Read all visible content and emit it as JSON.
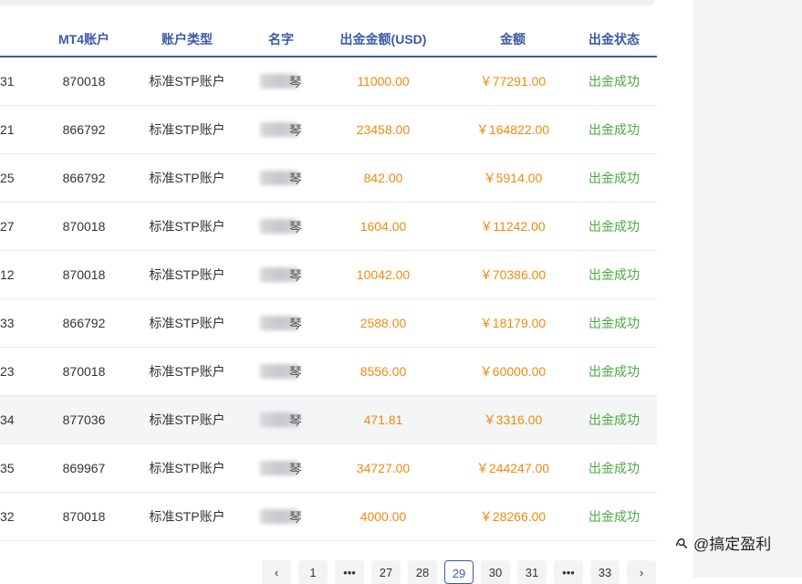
{
  "columns": {
    "mt4": "MT4账户",
    "type": "账户类型",
    "name": "名字",
    "usd": "出金金额(USD)",
    "cny": "金额",
    "status": "出金状态"
  },
  "rows": [
    {
      "id": "31",
      "mt4": "870018",
      "type": "标准STP账户",
      "name_char": "琴",
      "usd": "11000.00",
      "cny": "￥77291.00",
      "status": "出金成功"
    },
    {
      "id": "21",
      "mt4": "866792",
      "type": "标准STP账户",
      "name_char": "琴",
      "usd": "23458.00",
      "cny": "￥164822.00",
      "status": "出金成功"
    },
    {
      "id": "25",
      "mt4": "866792",
      "type": "标准STP账户",
      "name_char": "琴",
      "usd": "842.00",
      "cny": "￥5914.00",
      "status": "出金成功"
    },
    {
      "id": "27",
      "mt4": "870018",
      "type": "标准STP账户",
      "name_char": "琴",
      "usd": "1604.00",
      "cny": "￥11242.00",
      "status": "出金成功"
    },
    {
      "id": "12",
      "mt4": "870018",
      "type": "标准STP账户",
      "name_char": "琴",
      "usd": "10042.00",
      "cny": "￥70386.00",
      "status": "出金成功"
    },
    {
      "id": "33",
      "mt4": "866792",
      "type": "标准STP账户",
      "name_char": "琴",
      "usd": "2588.00",
      "cny": "￥18179.00",
      "status": "出金成功"
    },
    {
      "id": "23",
      "mt4": "870018",
      "type": "标准STP账户",
      "name_char": "琴",
      "usd": "8556.00",
      "cny": "￥60000.00",
      "status": "出金成功"
    },
    {
      "id": "34",
      "mt4": "877036",
      "type": "标准STP账户",
      "name_char": "琴",
      "usd": "471.81",
      "cny": "￥3316.00",
      "status": "出金成功"
    },
    {
      "id": "35",
      "mt4": "869967",
      "type": "标准STP账户",
      "name_char": "琴",
      "usd": "34727.00",
      "cny": "￥244247.00",
      "status": "出金成功"
    },
    {
      "id": "32",
      "mt4": "870018",
      "type": "标准STP账户",
      "name_char": "琴",
      "usd": "4000.00",
      "cny": "￥28266.00",
      "status": "出金成功"
    }
  ],
  "pagination": {
    "prev": "‹",
    "pages": [
      "1",
      "•••",
      "27",
      "28",
      "29",
      "30",
      "31",
      "•••",
      "33"
    ],
    "active": "29",
    "next": "›"
  },
  "watermark": {
    "text": "@搞定盈利",
    "icon": "zhihu-icon"
  }
}
